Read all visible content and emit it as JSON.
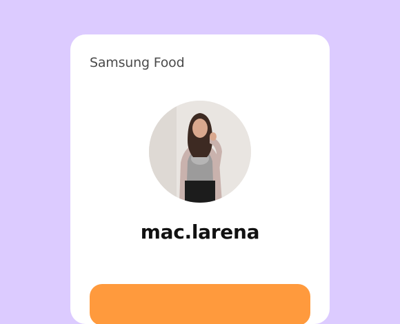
{
  "card": {
    "brand": "Samsung Food",
    "username": "mac.larena",
    "avatar_alt": "profile photo"
  },
  "colors": {
    "background": "#dccbff",
    "card": "#ffffff",
    "accent": "#ff9a3d"
  }
}
